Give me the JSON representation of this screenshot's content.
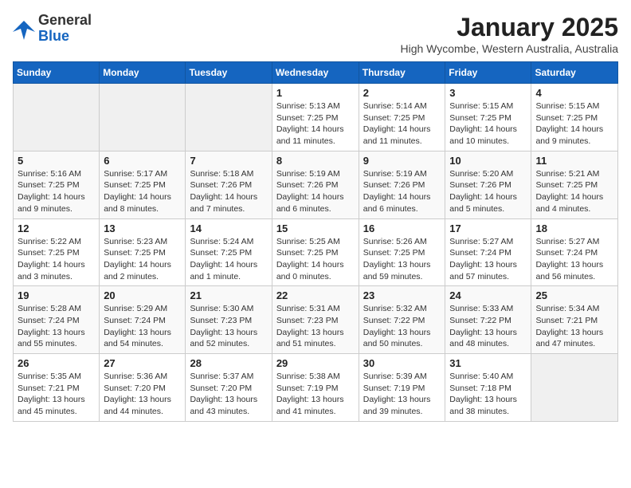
{
  "header": {
    "logo_general": "General",
    "logo_blue": "Blue",
    "month": "January 2025",
    "location": "High Wycombe, Western Australia, Australia"
  },
  "weekdays": [
    "Sunday",
    "Monday",
    "Tuesday",
    "Wednesday",
    "Thursday",
    "Friday",
    "Saturday"
  ],
  "weeks": [
    [
      {
        "day": "",
        "info": ""
      },
      {
        "day": "",
        "info": ""
      },
      {
        "day": "",
        "info": ""
      },
      {
        "day": "1",
        "info": "Sunrise: 5:13 AM\nSunset: 7:25 PM\nDaylight: 14 hours\nand 11 minutes."
      },
      {
        "day": "2",
        "info": "Sunrise: 5:14 AM\nSunset: 7:25 PM\nDaylight: 14 hours\nand 11 minutes."
      },
      {
        "day": "3",
        "info": "Sunrise: 5:15 AM\nSunset: 7:25 PM\nDaylight: 14 hours\nand 10 minutes."
      },
      {
        "day": "4",
        "info": "Sunrise: 5:15 AM\nSunset: 7:25 PM\nDaylight: 14 hours\nand 9 minutes."
      }
    ],
    [
      {
        "day": "5",
        "info": "Sunrise: 5:16 AM\nSunset: 7:25 PM\nDaylight: 14 hours\nand 9 minutes."
      },
      {
        "day": "6",
        "info": "Sunrise: 5:17 AM\nSunset: 7:25 PM\nDaylight: 14 hours\nand 8 minutes."
      },
      {
        "day": "7",
        "info": "Sunrise: 5:18 AM\nSunset: 7:26 PM\nDaylight: 14 hours\nand 7 minutes."
      },
      {
        "day": "8",
        "info": "Sunrise: 5:19 AM\nSunset: 7:26 PM\nDaylight: 14 hours\nand 6 minutes."
      },
      {
        "day": "9",
        "info": "Sunrise: 5:19 AM\nSunset: 7:26 PM\nDaylight: 14 hours\nand 6 minutes."
      },
      {
        "day": "10",
        "info": "Sunrise: 5:20 AM\nSunset: 7:26 PM\nDaylight: 14 hours\nand 5 minutes."
      },
      {
        "day": "11",
        "info": "Sunrise: 5:21 AM\nSunset: 7:25 PM\nDaylight: 14 hours\nand 4 minutes."
      }
    ],
    [
      {
        "day": "12",
        "info": "Sunrise: 5:22 AM\nSunset: 7:25 PM\nDaylight: 14 hours\nand 3 minutes."
      },
      {
        "day": "13",
        "info": "Sunrise: 5:23 AM\nSunset: 7:25 PM\nDaylight: 14 hours\nand 2 minutes."
      },
      {
        "day": "14",
        "info": "Sunrise: 5:24 AM\nSunset: 7:25 PM\nDaylight: 14 hours\nand 1 minute."
      },
      {
        "day": "15",
        "info": "Sunrise: 5:25 AM\nSunset: 7:25 PM\nDaylight: 14 hours\nand 0 minutes."
      },
      {
        "day": "16",
        "info": "Sunrise: 5:26 AM\nSunset: 7:25 PM\nDaylight: 13 hours\nand 59 minutes."
      },
      {
        "day": "17",
        "info": "Sunrise: 5:27 AM\nSunset: 7:24 PM\nDaylight: 13 hours\nand 57 minutes."
      },
      {
        "day": "18",
        "info": "Sunrise: 5:27 AM\nSunset: 7:24 PM\nDaylight: 13 hours\nand 56 minutes."
      }
    ],
    [
      {
        "day": "19",
        "info": "Sunrise: 5:28 AM\nSunset: 7:24 PM\nDaylight: 13 hours\nand 55 minutes."
      },
      {
        "day": "20",
        "info": "Sunrise: 5:29 AM\nSunset: 7:24 PM\nDaylight: 13 hours\nand 54 minutes."
      },
      {
        "day": "21",
        "info": "Sunrise: 5:30 AM\nSunset: 7:23 PM\nDaylight: 13 hours\nand 52 minutes."
      },
      {
        "day": "22",
        "info": "Sunrise: 5:31 AM\nSunset: 7:23 PM\nDaylight: 13 hours\nand 51 minutes."
      },
      {
        "day": "23",
        "info": "Sunrise: 5:32 AM\nSunset: 7:22 PM\nDaylight: 13 hours\nand 50 minutes."
      },
      {
        "day": "24",
        "info": "Sunrise: 5:33 AM\nSunset: 7:22 PM\nDaylight: 13 hours\nand 48 minutes."
      },
      {
        "day": "25",
        "info": "Sunrise: 5:34 AM\nSunset: 7:21 PM\nDaylight: 13 hours\nand 47 minutes."
      }
    ],
    [
      {
        "day": "26",
        "info": "Sunrise: 5:35 AM\nSunset: 7:21 PM\nDaylight: 13 hours\nand 45 minutes."
      },
      {
        "day": "27",
        "info": "Sunrise: 5:36 AM\nSunset: 7:20 PM\nDaylight: 13 hours\nand 44 minutes."
      },
      {
        "day": "28",
        "info": "Sunrise: 5:37 AM\nSunset: 7:20 PM\nDaylight: 13 hours\nand 43 minutes."
      },
      {
        "day": "29",
        "info": "Sunrise: 5:38 AM\nSunset: 7:19 PM\nDaylight: 13 hours\nand 41 minutes."
      },
      {
        "day": "30",
        "info": "Sunrise: 5:39 AM\nSunset: 7:19 PM\nDaylight: 13 hours\nand 39 minutes."
      },
      {
        "day": "31",
        "info": "Sunrise: 5:40 AM\nSunset: 7:18 PM\nDaylight: 13 hours\nand 38 minutes."
      },
      {
        "day": "",
        "info": ""
      }
    ]
  ]
}
